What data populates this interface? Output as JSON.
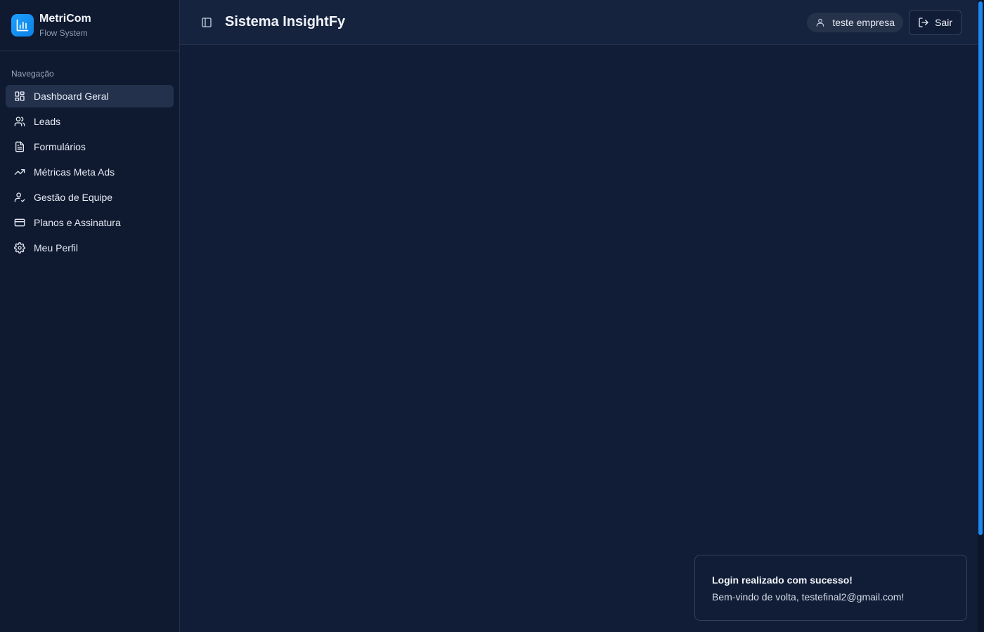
{
  "brand": {
    "name": "MetriCom",
    "subtitle": "Flow System",
    "icon": "bar-chart-icon"
  },
  "sidebar": {
    "group_label": "Navegação",
    "items": [
      {
        "label": "Dashboard Geral",
        "icon": "layout-grid-icon",
        "active": true
      },
      {
        "label": "Leads",
        "icon": "users-icon",
        "active": false
      },
      {
        "label": "Formulários",
        "icon": "file-text-icon",
        "active": false
      },
      {
        "label": "Métricas Meta Ads",
        "icon": "trending-up-icon",
        "active": false
      },
      {
        "label": "Gestão de Equipe",
        "icon": "user-check-icon",
        "active": false
      },
      {
        "label": "Planos e Assinatura",
        "icon": "credit-card-icon",
        "active": false
      },
      {
        "label": "Meu Perfil",
        "icon": "settings-icon",
        "active": false
      }
    ]
  },
  "header": {
    "title": "Sistema InsightFy",
    "user_name": "teste empresa",
    "logout_label": "Sair"
  },
  "toast": {
    "title": "Login realizado com sucesso!",
    "description": "Bem-vindo de volta, testefinal2@gmail.com!"
  },
  "colors": {
    "background": "#111d36",
    "sidebar": "#0f1a30",
    "accent": "#1ea0ff",
    "active_item": "#23314c"
  }
}
